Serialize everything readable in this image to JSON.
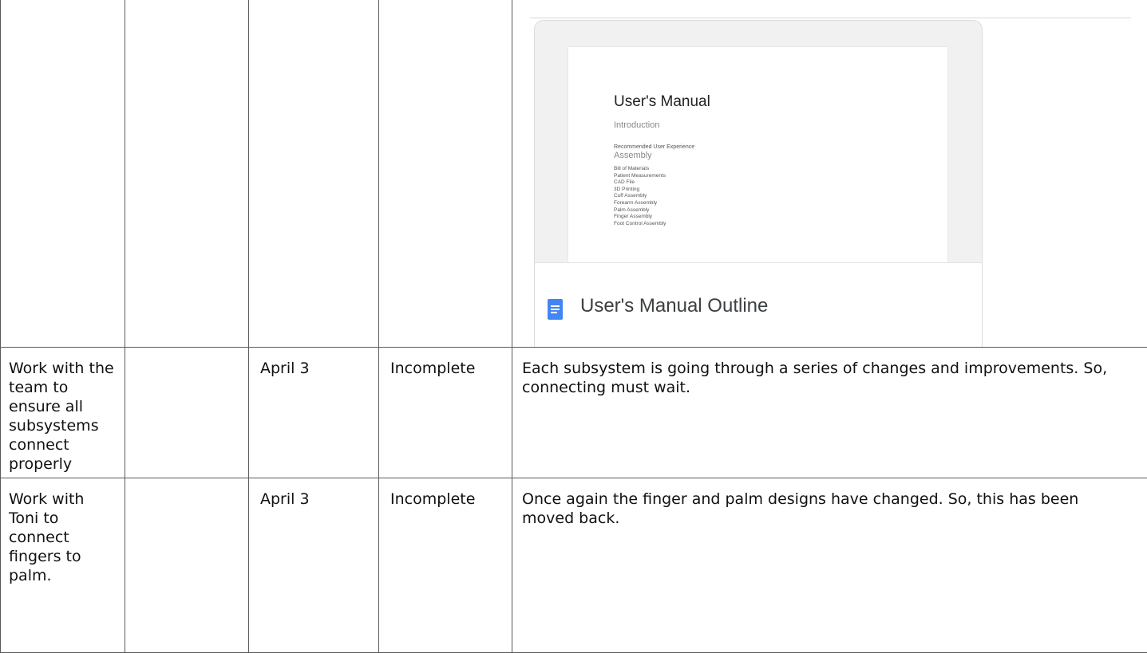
{
  "preview": {
    "doc_title": "User's Manual",
    "intro": "Introduction",
    "recommended": "Recommended User Experience",
    "assembly": "Assembly",
    "items": [
      "Bill of Materials",
      "Patient Measurements",
      "CAD File",
      "3D Printing",
      "Cuff Assembly",
      "Forearm Assembly",
      "Palm Assembly",
      "Finger Assembly",
      "Foot Control Assembly"
    ],
    "file_title": "User's Manual Outline",
    "file_icon": "google-docs-icon",
    "icon_color": "#4285f4"
  },
  "rows": [
    {
      "task": "Work with the team to\nensure all subsystems\nconnect properly",
      "assigned": "",
      "date": "April 3",
      "status": "Incomplete",
      "notes": "Each subsystem is going through a series of changes and improvements. So, connecting must wait."
    },
    {
      "task": "Work with Toni to\nconnect fingers to\npalm.",
      "assigned": "",
      "date": "April 3",
      "status": "Incomplete",
      "notes": "Once again the finger and palm designs have changed. So, this has been moved back."
    }
  ]
}
